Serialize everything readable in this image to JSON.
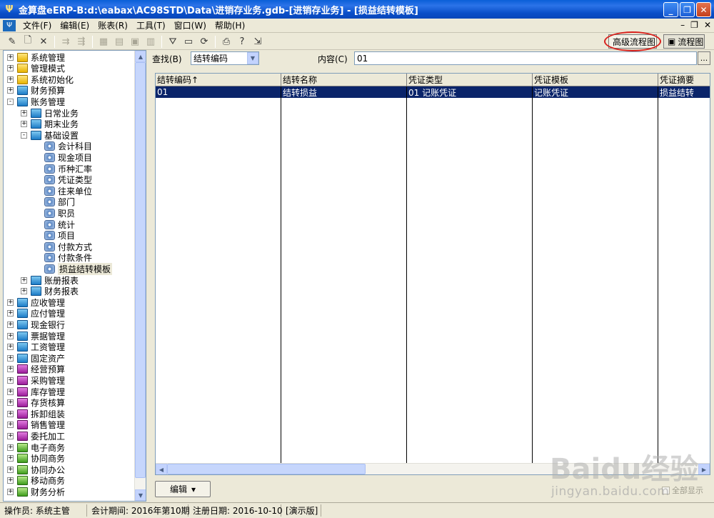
{
  "window": {
    "title": "金算盘eERP-B:d:\\eabax\\AC98STD\\Data\\进销存业务.gdb-[进销存业务] - [损益结转模板]",
    "app_icon": "abacus-icon"
  },
  "menu": {
    "items": [
      "文件(F)",
      "编辑(E)",
      "账表(R)",
      "工具(T)",
      "窗口(W)",
      "帮助(H)"
    ]
  },
  "toolbar": {
    "advanced_flow_label": "高级流程图",
    "flow_label": "流程图"
  },
  "tree": {
    "items": [
      {
        "label": "系统管理",
        "expander": "+",
        "icon": "yellow-book"
      },
      {
        "label": "管理模式",
        "expander": "+",
        "icon": "yellow-book"
      },
      {
        "label": "系统初始化",
        "expander": "+",
        "icon": "yellow-book"
      },
      {
        "label": "财务预算",
        "expander": "+",
        "icon": "blue-book"
      },
      {
        "label": "账务管理",
        "expander": "-",
        "icon": "blue-book"
      },
      {
        "label": "日常业务",
        "expander": "+",
        "icon": "blue-book"
      },
      {
        "label": "期末业务",
        "expander": "+",
        "icon": "blue-book"
      },
      {
        "label": "基础设置",
        "expander": "-",
        "icon": "blue-book"
      },
      {
        "label": "会计科目",
        "icon": "gear-doc"
      },
      {
        "label": "现金项目",
        "icon": "gear-doc"
      },
      {
        "label": "币种汇率",
        "icon": "gear-doc"
      },
      {
        "label": "凭证类型",
        "icon": "gear-doc"
      },
      {
        "label": "往来单位",
        "icon": "gear-doc"
      },
      {
        "label": "部门",
        "icon": "gear-doc"
      },
      {
        "label": "职员",
        "icon": "gear-doc"
      },
      {
        "label": "统计",
        "icon": "gear-doc"
      },
      {
        "label": "项目",
        "icon": "gear-doc"
      },
      {
        "label": "付款方式",
        "icon": "gear-doc"
      },
      {
        "label": "付款条件",
        "icon": "gear-doc"
      },
      {
        "label": "损益结转模板",
        "icon": "gear-doc",
        "selected": true
      },
      {
        "label": "账册报表",
        "expander": "+",
        "icon": "blue-book"
      },
      {
        "label": "财务报表",
        "expander": "+",
        "icon": "blue-book"
      },
      {
        "label": "应收管理",
        "expander": "+",
        "icon": "blue-book"
      },
      {
        "label": "应付管理",
        "expander": "+",
        "icon": "blue-book"
      },
      {
        "label": "现金银行",
        "expander": "+",
        "icon": "blue-book"
      },
      {
        "label": "票据管理",
        "expander": "+",
        "icon": "blue-book"
      },
      {
        "label": "工资管理",
        "expander": "+",
        "icon": "blue-book"
      },
      {
        "label": "固定资产",
        "expander": "+",
        "icon": "blue-book"
      },
      {
        "label": "经营预算",
        "expander": "+",
        "icon": "purple-book"
      },
      {
        "label": "采购管理",
        "expander": "+",
        "icon": "purple-book"
      },
      {
        "label": "库存管理",
        "expander": "+",
        "icon": "purple-book"
      },
      {
        "label": "存货核算",
        "expander": "+",
        "icon": "purple-book"
      },
      {
        "label": "拆卸组装",
        "expander": "+",
        "icon": "purple-book"
      },
      {
        "label": "销售管理",
        "expander": "+",
        "icon": "purple-book"
      },
      {
        "label": "委托加工",
        "expander": "+",
        "icon": "purple-book"
      },
      {
        "label": "电子商务",
        "expander": "+",
        "icon": "green-book"
      },
      {
        "label": "协同商务",
        "expander": "+",
        "icon": "green-book"
      },
      {
        "label": "协同办公",
        "expander": "+",
        "icon": "green-book"
      },
      {
        "label": "移动商务",
        "expander": "+",
        "icon": "green-book"
      },
      {
        "label": "财务分析",
        "expander": "+",
        "icon": "green-book"
      }
    ]
  },
  "search": {
    "find_label": "查找(B)",
    "find_value": "结转编码",
    "content_label": "内容(C)",
    "content_value": "01",
    "more_label": "..."
  },
  "grid": {
    "columns": [
      "结转编码↑",
      "结转名称",
      "凭证类型",
      "凭证模板",
      "凭证摘要"
    ],
    "rows": [
      [
        "01",
        "结转损益",
        "01 记账凭证",
        "记账凭证",
        "损益结转"
      ]
    ]
  },
  "bottom": {
    "edit_label": "编辑",
    "all_label": "全部显示"
  },
  "status": {
    "operator": "操作员: 系统主管",
    "period": "会计期间: 2016年第10期",
    "reg_date": "注册日期: 2016-10-10",
    "edition": "[演示版]"
  },
  "watermark": {
    "brand": "Baidu经验",
    "url": "jingyan.baidu.com"
  }
}
